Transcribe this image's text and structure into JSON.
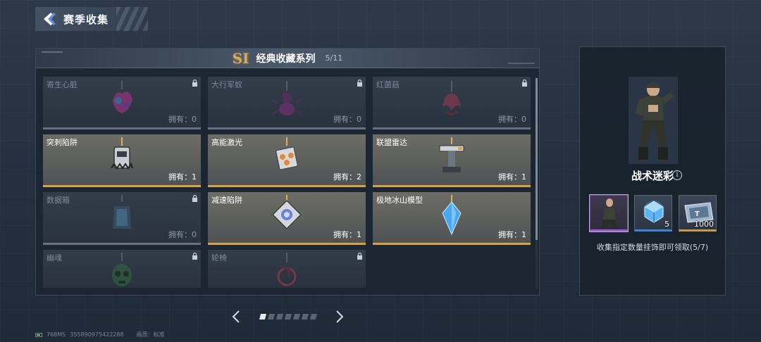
{
  "header": {
    "title": "赛季收集",
    "back_icon": "back-arrow-icon"
  },
  "series": {
    "badge": "SI",
    "title": "经典收藏系列",
    "count": "5/11"
  },
  "colors": {
    "gold_accent": "#d8a145",
    "locked_border": "#66707e",
    "rarity_purple": "#9b63c9",
    "rarity_blue": "#3d86d4",
    "rarity_gold": "#c99a4c"
  },
  "items": [
    {
      "name": "寄生心脏",
      "count": "拥有：0",
      "owned": false,
      "icon": "parasite-heart-charm-icon"
    },
    {
      "name": "大行军蚁",
      "count": "拥有：0",
      "owned": false,
      "icon": "army-ant-charm-icon"
    },
    {
      "name": "红菌菇",
      "count": "拥有：0",
      "owned": false,
      "icon": "red-mushroom-charm-icon"
    },
    {
      "name": "突刺陷阱",
      "count": "拥有：1",
      "owned": true,
      "icon": "spike-trap-charm-icon"
    },
    {
      "name": "高能激光",
      "count": "拥有：2",
      "owned": true,
      "icon": "laser-charm-icon"
    },
    {
      "name": "联盟雷达",
      "count": "拥有：1",
      "owned": true,
      "icon": "radar-charm-icon"
    },
    {
      "name": "数据箱",
      "count": "拥有：0",
      "owned": false,
      "icon": "data-box-charm-icon"
    },
    {
      "name": "减速陷阱",
      "count": "拥有：1",
      "owned": true,
      "icon": "slow-trap-charm-icon"
    },
    {
      "name": "极地冰山模型",
      "count": "拥有：1",
      "owned": true,
      "icon": "ice-crystal-charm-icon"
    },
    {
      "name": "幽魂",
      "count": "",
      "owned": false,
      "icon": "ghost-skull-charm-icon"
    },
    {
      "name": "轮椅",
      "count": "",
      "owned": false,
      "icon": "wheelchair-charm-icon"
    }
  ],
  "pagination": {
    "pages": 7,
    "current": 1
  },
  "reward": {
    "title": "战术迷彩",
    "info_icon_glyph": "i",
    "items": [
      {
        "type": "outfit",
        "qty": "",
        "rarity": "purple",
        "icon": "soldier-outfit-icon"
      },
      {
        "type": "supply-box",
        "qty": "5",
        "rarity": "blue",
        "icon": "supply-box-icon"
      },
      {
        "type": "currency",
        "qty": "1000",
        "rarity": "gold",
        "icon": "ticket-icon"
      }
    ],
    "description": "收集指定数量挂饰即可领取(5/7)"
  },
  "footer": {
    "ping": "768MS",
    "id": "355890975422288",
    "quality": "画质：标准"
  }
}
